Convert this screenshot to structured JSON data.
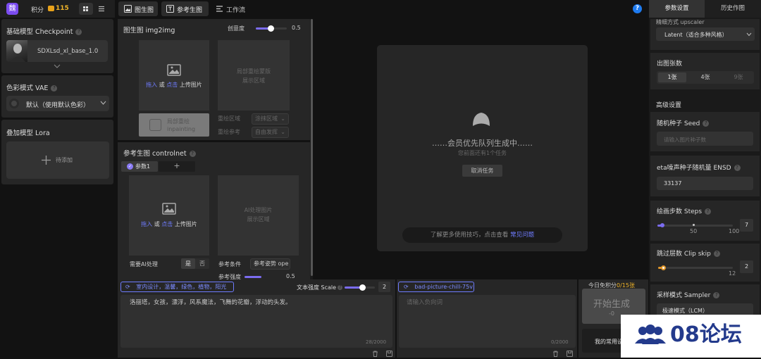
{
  "app": {
    "logo_char": "魏",
    "points_label": "积分",
    "points_value": "115"
  },
  "nav": {
    "tabs": [
      {
        "label": "图生图"
      },
      {
        "label": "参考生图"
      },
      {
        "label": "工作流"
      }
    ],
    "help": "?"
  },
  "left": {
    "checkpoint_title": "基础模型 Checkpoint",
    "checkpoint_name": "SDXLsd_xl_base_1.0",
    "vae_title": "色彩模式 VAE",
    "vae_value": "默认（使用默认色彩）",
    "lora_title": "叠加模型 Lora",
    "lora_add": "待添加"
  },
  "img2img": {
    "title": "图生图 img2img",
    "creativity_label": "创意度",
    "creativity_value": "0.5",
    "creativity_fraction": 0.5,
    "upload_drag": "拖入",
    "upload_or": "或",
    "upload_click": "点击",
    "upload_text": "上传图片",
    "mask_area": "局部重绘蒙版\n展示区域",
    "inpaint_btn": "局部重绘\ninpainting",
    "opt1_label": "重绘区域",
    "opt1_value": "涂抹区域",
    "opt2_label": "重绘参考",
    "opt2_value": "自由发挥"
  },
  "controlnet": {
    "title": "参考生图 controlnet",
    "tab1": "参数1",
    "tab_add": "+",
    "ai_area": "AI处理图片\n展示区域",
    "need_ai_label": "需要AI处理",
    "yes": "是",
    "no": "否",
    "condition_label": "参考条件",
    "condition_value": "参考姿势 ope",
    "strength_label": "参考强度",
    "strength_value": "0.5"
  },
  "preview": {
    "queue_text": "……会员优先队列生成中……",
    "ahead_text": "您前面还有1个任务",
    "cancel": "取消任务",
    "tip_text": "了解更多使用技巧，点击查看",
    "tip_link": "常见问题"
  },
  "prompt": {
    "tag": "室内设计，温馨，绿色，植物，阳光",
    "scale_label": "文本强度 Scale",
    "scale_value": "2",
    "scale_fraction": 0.6,
    "text": "洛丽塔，女孩，漂浮，风系魔法，飞舞的花瓣，浮动的头发。",
    "count": "28/2000"
  },
  "negative": {
    "tag": "bad-picture-chill-75v",
    "placeholder": "请输入负向词",
    "count": "0/2000"
  },
  "generate": {
    "free_label": "今日免积分",
    "free_value": "0",
    "free_total": "/15张",
    "button": "开始生成",
    "cost": "-0",
    "my_common": "我的常用设"
  },
  "right": {
    "tabs": [
      {
        "label": "参数设置"
      },
      {
        "label": "历史作图"
      }
    ],
    "upscaler_label": "精细方式 upscaler",
    "upscaler_value": "Latent（适合多种风格）",
    "count_title": "出图张数",
    "count_options": [
      "1张",
      "4张",
      "9张"
    ],
    "advanced_title": "高级设置",
    "seed_title": "随机种子 Seed",
    "seed_placeholder": "请输入图片种子数",
    "ensd_title": "eta噪声种子随机量 ENSD",
    "ensd_value": "33137",
    "steps_title": "绘画步数 Steps",
    "steps_mark": "50",
    "steps_max": "100",
    "steps_value": "7",
    "steps_fraction": 0.07,
    "clip_title": "跳过层数 Clip skip",
    "clip_max": "12",
    "clip_value": "2",
    "clip_fraction": 0.08,
    "sampler_title": "采样模式 Sampler",
    "sampler_value": "极速模式（LCM）"
  },
  "watermark": {
    "text": "08论坛"
  }
}
